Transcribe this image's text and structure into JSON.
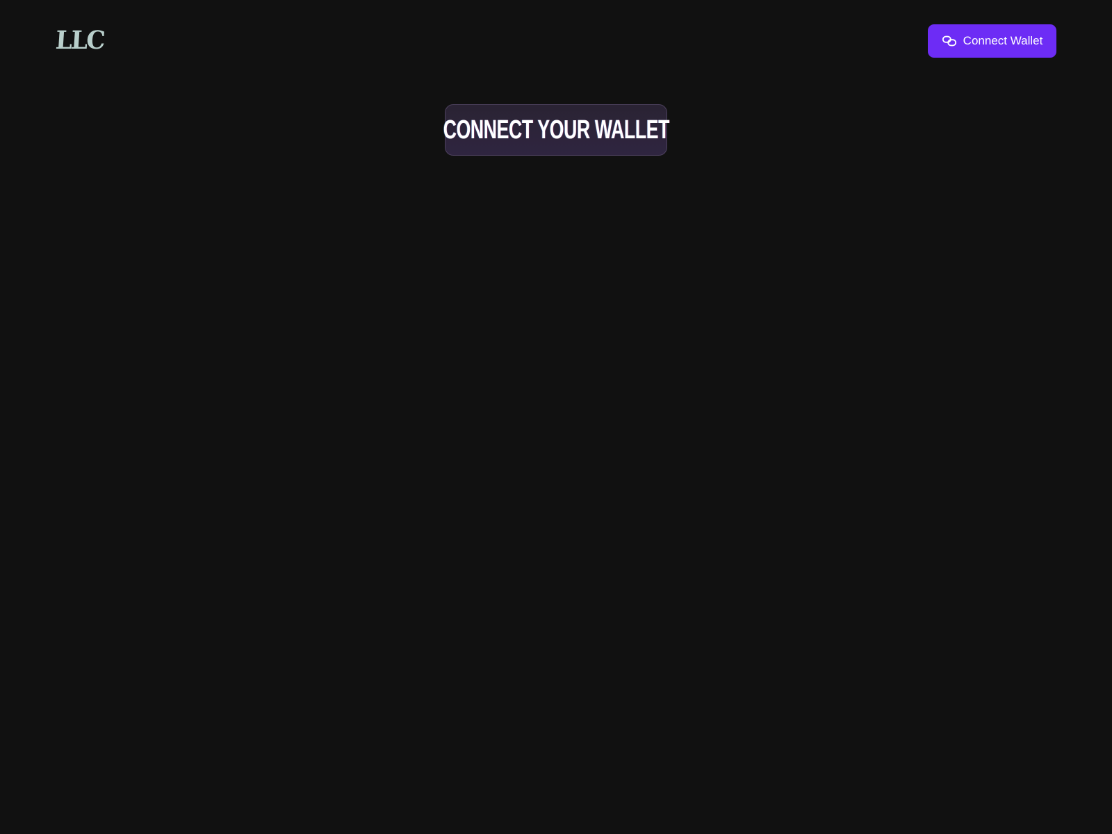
{
  "header": {
    "logo_text": "LLC",
    "connect_button": {
      "label": "Connect Wallet",
      "icon": "link-icon"
    }
  },
  "main": {
    "title": "CONNECT YOUR WALLET"
  },
  "colors": {
    "background": "#111111",
    "accent": "#6d2cf5",
    "logo": "#b9cfcb",
    "text": "#ffffff"
  }
}
